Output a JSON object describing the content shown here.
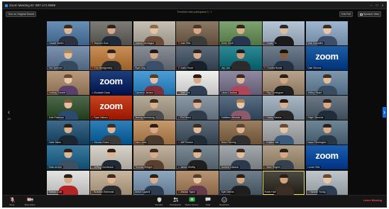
{
  "window": {
    "app_title": "Zoom Meeting ID: 897-171-9599"
  },
  "topbar": {
    "left_button": "Turn on Original Sound",
    "meeting_title": "Trendline video participants 0 · 1",
    "exit_button": "Exit Full",
    "view_button": "Speaker View"
  },
  "nav": {
    "left_arrow": "‹",
    "right_arrow": "›",
    "page_left": "1/3",
    "page_right": "1/3"
  },
  "tiles": [
    {
      "name": "Claude Martin",
      "bg": "#6a8fb5",
      "skin": "#e0b894",
      "shirt": "#2b3140",
      "hair": "#3a2a1f",
      "zoom": false,
      "muted": false
    },
    {
      "name": "Stephen Dow",
      "bg": "#7e7c77",
      "skin": "#d9aa86",
      "shirt": "#1e2a38",
      "hair": "#2b221c",
      "zoom": false,
      "muted": true
    },
    {
      "name": "Joanne Montague",
      "bg": "#c7c0b4",
      "skin": "#e6c2a4",
      "shirt": "#6a4b3a",
      "hair": "#8a6b4f",
      "zoom": false,
      "muted": false
    },
    {
      "name": "Josh Hills",
      "bg": "#8c7a66",
      "skin": "#d7a884",
      "shirt": "#3a3a3a",
      "hair": "#4b3727",
      "zoom": false,
      "muted": true
    },
    {
      "name": "Kevin Scott",
      "bg": "#7ea371",
      "skin": "#d9b08a",
      "shirt": "#27354f",
      "hair": "#2f251d",
      "zoom": false,
      "muted": false
    },
    {
      "name": "Dustin Yo",
      "bg": "#b7c6d6",
      "skin": "#e0bb98",
      "shirt": "#1b1b1b",
      "hair": "#2a2a2a",
      "zoom": false,
      "muted": true
    },
    {
      "name": "Matt Gonzalez",
      "bg": "#9fb6d0",
      "skin": "#e7c5a8",
      "shirt": "#3d4d6b",
      "hair": "#3d2c1f",
      "zoom": false,
      "muted": false
    },
    {
      "name": "Kirk Spencer",
      "bg": "#7c93b0",
      "skin": "#e4bd9b",
      "shirt": "#34495e",
      "hair": "#a8875e",
      "zoom": false,
      "muted": false
    },
    {
      "name": "Rob Montgomery",
      "bg": "#c98f56",
      "skin": "#d8a47f",
      "shirt": "#2a2a2a",
      "hair": "#2c2119",
      "zoom": false,
      "muted": true
    },
    {
      "name": "Ryan Ang",
      "bg": "#8a8f97",
      "skin": "#d5a789",
      "shirt": "#3b5068",
      "hair": "#1f1a15",
      "zoom": false,
      "muted": false
    },
    {
      "name": "Justin Howe",
      "bg": "#5d6b7a",
      "skin": "#dcae8c",
      "shirt": "#19202a",
      "hair": "#2c241e",
      "zoom": false,
      "muted": true
    },
    {
      "name": "Jay Lieu",
      "bg": "#2f8a96",
      "skin": "#c99a7a",
      "shirt": "#2b2b2b",
      "hair": "#1a1a1a",
      "zoom": false,
      "muted": false
    },
    {
      "name": "Charles Bowls",
      "bg": "#6f7f8f",
      "skin": "#8a5a3c",
      "shirt": "#233142",
      "hair": "#1a1410",
      "zoom": false,
      "muted": true
    },
    {
      "name": "Dale Simone",
      "bg": "#1d5fa6",
      "skin": "#000000",
      "shirt": "#000000",
      "hair": "#000000",
      "zoom": true,
      "muted": false
    },
    {
      "name": "Lindsay Everett",
      "bg": "#b89a7e",
      "skin": "#e8c7aa",
      "shirt": "#5a3f6b",
      "hair": "#6b4a2f",
      "zoom": false,
      "muted": false
    },
    {
      "name": "Elizabeth Dean",
      "bg": "#1e3f7a",
      "skin": "#000000",
      "shirt": "#000000",
      "hair": "#000000",
      "zoom": true,
      "muted": true
    },
    {
      "name": "Cameron Jensen",
      "bg": "#4d9ed6",
      "skin": "#e5c0a0",
      "shirt": "#7a2f3a",
      "hair": "#5a3b24",
      "zoom": false,
      "muted": false
    },
    {
      "name": "Josh Lee",
      "bg": "#f0f0ee",
      "skin": "#d9aa88",
      "shirt": "#2f3e52",
      "hair": "#2a2019",
      "zoom": false,
      "muted": true
    },
    {
      "name": "Laura Cardoza",
      "bg": "#8f8aa2",
      "skin": "#e2b997",
      "shirt": "#b0455a",
      "hair": "#3b2a1e",
      "zoom": false,
      "muted": false
    },
    {
      "name": "Ray Dominguez",
      "bg": "#b8a48d",
      "skin": "#d6a47f",
      "shirt": "#1f1f1f",
      "hair": "#2a1f18",
      "zoom": false,
      "muted": true
    },
    {
      "name": "Jeffrey Stuart",
      "bg": "#7e98b0",
      "skin": "#e2bd9c",
      "shirt": "#394b5f",
      "hair": "#3f2f24",
      "zoom": false,
      "muted": false
    },
    {
      "name": "Julie Peterson",
      "bg": "#4e6a4a",
      "skin": "#e4c0a1",
      "shirt": "#2b4a6f",
      "hair": "#7b5a3d",
      "zoom": false,
      "muted": false
    },
    {
      "name": "Ryan Nelson",
      "bg": "#c8431e",
      "skin": "#000000",
      "shirt": "#000000",
      "hair": "#000000",
      "zoom": true,
      "muted": true
    },
    {
      "name": "Jeremy Armstrong",
      "bg": "#b7ab9a",
      "skin": "#d8ae8c",
      "shirt": "#4b4b4b",
      "hair": "#3a2b20",
      "zoom": false,
      "muted": false
    },
    {
      "name": "Phil Reed",
      "bg": "#8d9aa8",
      "skin": "#e0b492",
      "shirt": "#2d3b4a",
      "hair": "#4a3425",
      "zoom": false,
      "muted": true
    },
    {
      "name": "Kathleen Wheeler",
      "bg": "#5a6f84",
      "skin": "#e9c6a8",
      "shirt": "#8c5a6b",
      "hair": "#a8805a",
      "zoom": false,
      "muted": false
    },
    {
      "name": "Casey Santos",
      "bg": "#a9b8c4",
      "skin": "#dcae8c",
      "shirt": "#262626",
      "hair": "#241b15",
      "zoom": false,
      "muted": true
    },
    {
      "name": "Ralph Stevens",
      "bg": "#6c7986",
      "skin": "#d9a985",
      "shirt": "#1f2c3a",
      "hair": "#2e2219",
      "zoom": false,
      "muted": false
    },
    {
      "name": "Gabe Mann",
      "bg": "#3f6a8a",
      "skin": "#dcaf8c",
      "shirt": "#1b2633",
      "hair": "#2a1f17",
      "zoom": false,
      "muted": false
    },
    {
      "name": "Nicolas Evans",
      "bg": "#2f7fb8",
      "skin": "#e0b694",
      "shirt": "#3a3a3a",
      "hair": "#3d2d21",
      "zoom": false,
      "muted": true
    },
    {
      "name": "Sam Lewis",
      "bg": "#c79a6e",
      "skin": "#d8aa86",
      "shirt": "#4a3a2e",
      "hair": "#2b2119",
      "zoom": false,
      "muted": false
    },
    {
      "name": "Jeff Preston",
      "bg": "#5f6d7b",
      "skin": "#e3bb98",
      "shirt": "#212b36",
      "hair": "#3b2c21",
      "zoom": false,
      "muted": true
    },
    {
      "name": "Brian Fleming",
      "bg": "#9b7f63",
      "skin": "#e1b593",
      "shirt": "#2f2f2f",
      "hair": "#5a4330",
      "zoom": false,
      "muted": false
    },
    {
      "name": "Kristen Hall",
      "bg": "#b4b6b8",
      "skin": "#e8c4a6",
      "shirt": "#3b5a7a",
      "hair": "#6b4a30",
      "zoom": false,
      "muted": true
    },
    {
      "name": "Isaac Pennington",
      "bg": "#6f8696",
      "skin": "#dcae8a",
      "shirt": "#273544",
      "hair": "#2b221b",
      "zoom": false,
      "muted": false
    },
    {
      "name": "Brian Archer",
      "bg": "#3c7a9e",
      "skin": "#e1b793",
      "shirt": "#3c4f63",
      "hair": "#2e2218",
      "zoom": false,
      "muted": false
    },
    {
      "name": "Jeffrey Gunnerson",
      "bg": "#d8d4cc",
      "skin": "#e0b290",
      "shirt": "#1f2a36",
      "hair": "#2b2119",
      "zoom": false,
      "muted": true
    },
    {
      "name": "Thomas Bridges",
      "bg": "#c1b39f",
      "skin": "#dba985",
      "shirt": "#5a3f2f",
      "hair": "#3a2c20",
      "zoom": false,
      "muted": false
    },
    {
      "name": "James Shelby",
      "bg": "#7d8b96",
      "skin": "#dfb592",
      "shirt": "#1f1f1f",
      "hair": "#2b2017",
      "zoom": false,
      "muted": true
    },
    {
      "name": "Andrew Dawson",
      "bg": "#a3a9ad",
      "skin": "#e3bc9a",
      "shirt": "#2a3a4c",
      "hair": "#3a2b1f",
      "zoom": false,
      "muted": false
    },
    {
      "name": "Mark Rogers",
      "bg": "#b0a08a",
      "skin": "#d7a783",
      "shirt": "#35414f",
      "hair": "#2a2017",
      "zoom": false,
      "muted": true
    },
    {
      "name": "Lucas Ortiz",
      "bg": "#1a5fb0",
      "skin": "#000000",
      "shirt": "#000000",
      "hair": "#000000",
      "zoom": true,
      "muted": false
    },
    {
      "name": "Nathan Cole",
      "bg": "#e4e4e2",
      "skin": "#dba984",
      "shirt": "#b32424",
      "hair": "#2b2118",
      "zoom": false,
      "muted": false
    },
    {
      "name": "Brandon Edmonds",
      "bg": "#c9b7a0",
      "skin": "#e1b591",
      "shirt": "#2a2a2a",
      "hair": "#3e2d20",
      "zoom": false,
      "muted": true
    },
    {
      "name": "Anton Lupardi",
      "bg": "#8fa8bf",
      "skin": "#dcae8b",
      "shirt": "#2c3d52",
      "hair": "#2a2017",
      "zoom": false,
      "muted": false
    },
    {
      "name": "Jessica Taylor",
      "bg": "#b79474",
      "skin": "#e5c1a1",
      "shirt": "#663a4b",
      "hair": "#5a3d26",
      "zoom": false,
      "muted": true
    },
    {
      "name": "Kyle Dennis",
      "bg": "#6f7f8c",
      "skin": "#d8a883",
      "shirt": "#1e1e1e",
      "hair": "#2a1f16",
      "zoom": false,
      "muted": false
    },
    {
      "name": "Robin Hart",
      "bg": "#4e4b42",
      "skin": "#d6a27b",
      "shirt": "#3b2f23",
      "hair": "#2a1f16",
      "zoom": false,
      "muted": false,
      "active": true
    },
    {
      "name": "Hannah Young",
      "bg": "#bfc6cc",
      "skin": "#e8c6a8",
      "shirt": "#2e3e52",
      "hair": "#6a4a2e",
      "zoom": false,
      "muted": true
    }
  ],
  "zoom_logo_text": "zoom",
  "toolbar": {
    "left": [
      {
        "icon": "microphone-icon",
        "label": "Mute"
      },
      {
        "icon": "video-camera-icon",
        "label": "Stop Video"
      }
    ],
    "center": [
      {
        "icon": "security-icon",
        "label": "Security"
      },
      {
        "icon": "participants-icon",
        "label": "Participants"
      },
      {
        "icon": "share-screen-icon",
        "label": "Share Screen"
      },
      {
        "icon": "chat-icon",
        "label": "Chat"
      },
      {
        "icon": "reactions-icon",
        "label": "Reactions"
      }
    ],
    "end_label": "Leave Meeting"
  },
  "colors": {
    "share_green": "#2fb54a",
    "end_red": "#ff4b4b",
    "zoom_blue": "#2d8cff",
    "active_speaker": "#f2e35c"
  }
}
